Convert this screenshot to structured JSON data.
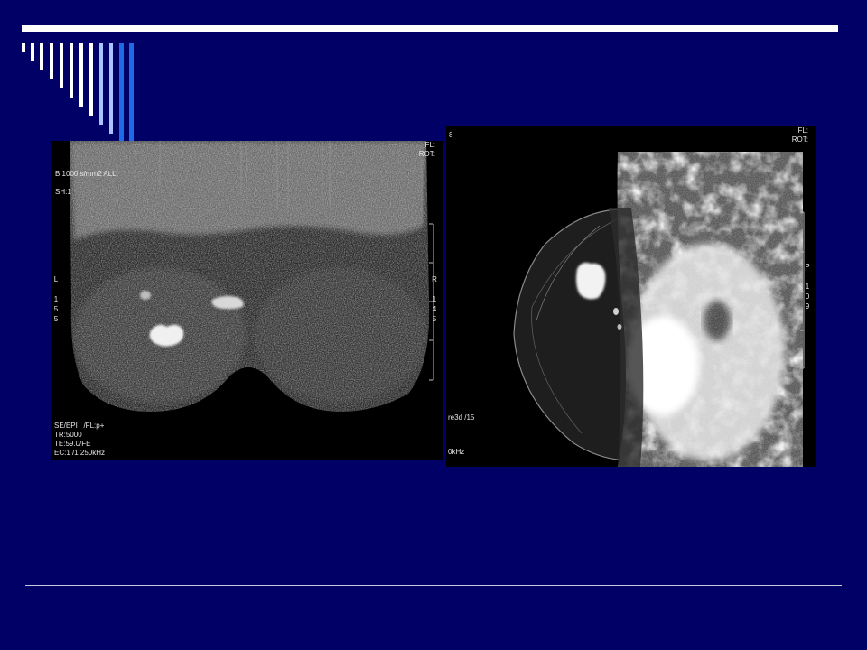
{
  "slide": {
    "colors": {
      "background": "#000066",
      "bar": "#ffffff",
      "stripe_white": "#ffffff",
      "stripe_light_blue": "#aac4ff",
      "stripe_blue": "#1e6be6",
      "rule": "#c8c8d8"
    }
  },
  "left_image": {
    "top_right": "FL:\nROT:",
    "top_left": "B:1000 s/mm2 ALL\n\nSH:1",
    "left_side": [
      "L",
      "",
      "1",
      "5",
      "5"
    ],
    "right_side": [
      "R",
      "",
      "1",
      "4",
      "5"
    ],
    "bottom_left": "SE/EPI   /FL:p+\nTR:5000\nTE:59.0/FE\nEC:1 /1 250kHz"
  },
  "right_image": {
    "top_left": "8",
    "top_right": "FL:\nROT:",
    "right_side": [
      "P",
      "",
      "1",
      "0",
      "9"
    ],
    "bottom_left_1": "re3d /15",
    "bottom_left_2": "0kHz"
  }
}
